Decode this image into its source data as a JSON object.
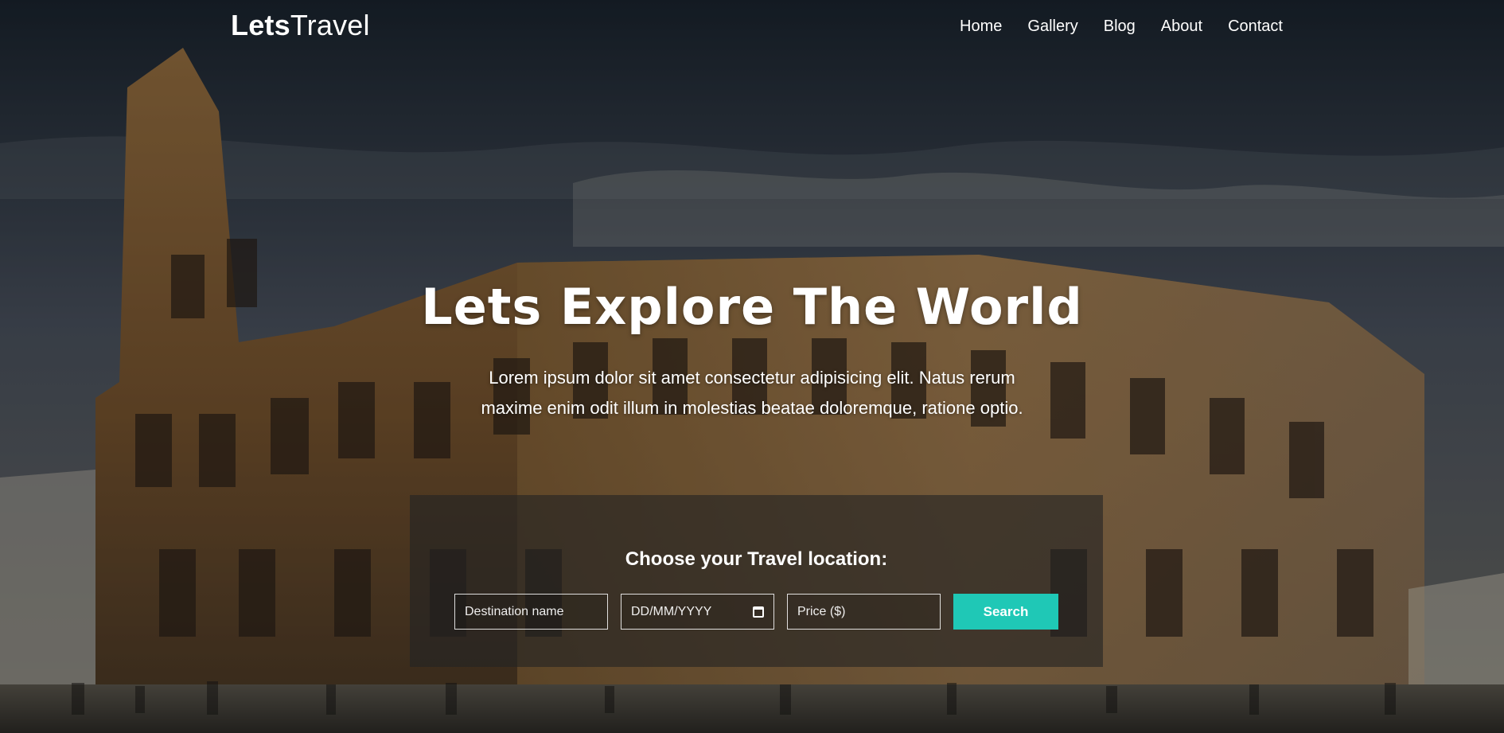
{
  "brand": {
    "bold": "Lets",
    "light": "Travel"
  },
  "nav": {
    "items": [
      {
        "label": "Home"
      },
      {
        "label": "Gallery"
      },
      {
        "label": "Blog"
      },
      {
        "label": "About"
      },
      {
        "label": "Contact"
      }
    ]
  },
  "hero": {
    "title": "Lets Explore The World",
    "subtitle": "Lorem ipsum dolor sit amet consectetur adipisicing elit. Natus rerum maxime enim odit illum in molestias beatae doloremque, ratione optio."
  },
  "search": {
    "title": "Choose your Travel location:",
    "destination_placeholder": "Destination name",
    "date_placeholder": "DD/MM/YYYY",
    "price_placeholder": "Price ($)",
    "button_label": "Search"
  },
  "colors": {
    "accent": "#1fc8b6",
    "panel": "rgba(35,35,35,0.62)"
  },
  "icons": {
    "calendar": "calendar-icon"
  }
}
